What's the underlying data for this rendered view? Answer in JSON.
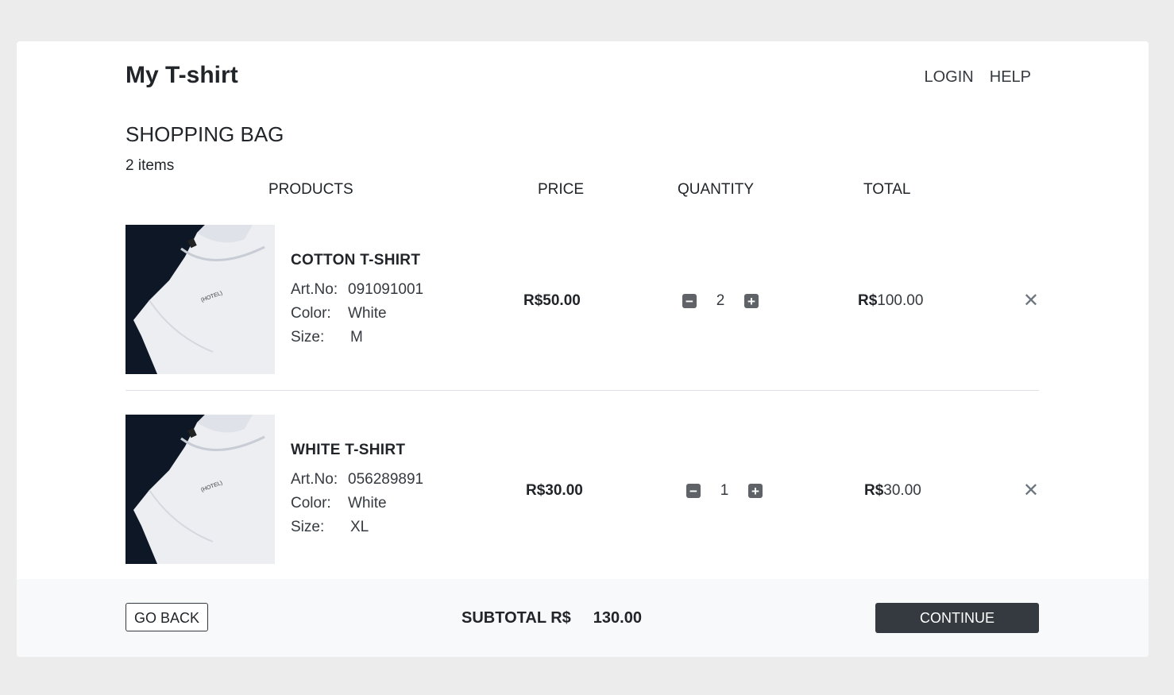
{
  "header": {
    "brand": "My T-shirt",
    "nav": [
      "LOGIN",
      "HELP"
    ]
  },
  "bag": {
    "title": "SHOPPING BAG",
    "count": "2 items",
    "columns": {
      "products": "PRODUCTS",
      "price": "PRICE",
      "quantity": "QUANTITY",
      "total": "TOTAL"
    },
    "items": [
      {
        "name": "COTTON T-SHIRT",
        "art_label": "Art.No:",
        "art": "091091001",
        "color_label": "Color:",
        "color": "White",
        "size_label": "Size:",
        "size": "M",
        "price": "R$50.00",
        "qty": "2",
        "total_cur": "R$",
        "total_val": "100.00",
        "remove": "✕"
      },
      {
        "name": "WHITE T-SHIRT",
        "art_label": "Art.No:",
        "art": "056289891",
        "color_label": "Color:",
        "color": "White",
        "size_label": "Size:",
        "size": "XL",
        "price": "R$30.00",
        "qty": "1",
        "total_cur": "R$",
        "total_val": "30.00",
        "remove": "✕"
      }
    ]
  },
  "footer": {
    "go_back": "GO BACK",
    "subtotal_label": "SUBTOTAL R$",
    "subtotal_value": "130.00",
    "continue": "CONTINUE"
  },
  "icons": {
    "minus": "minus-icon",
    "plus": "plus-icon",
    "close": "close-icon"
  },
  "colors": {
    "dark": "#343a40",
    "footer_bg": "#f8f9fa",
    "page_bg": "#ececec"
  }
}
